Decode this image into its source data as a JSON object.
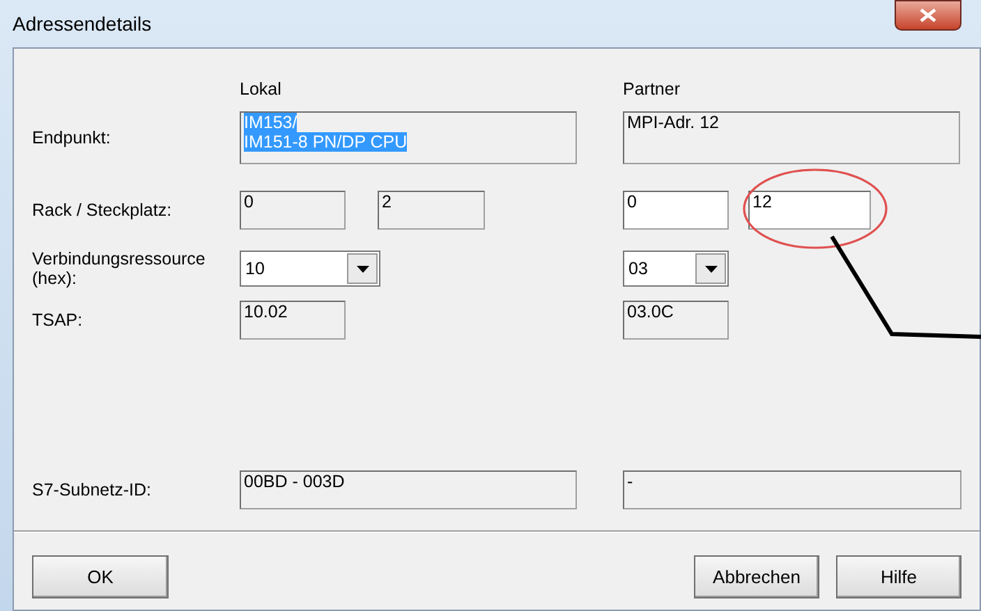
{
  "window": {
    "title": "Adressendetails"
  },
  "columns": [
    "Lokal",
    "Partner"
  ],
  "rows": [
    {
      "label": "Endpunkt:",
      "kind": "wide",
      "local": [
        {
          "value": "IM153/\nIM151-8 PN/DP CPU",
          "disabled": true,
          "selected": true
        }
      ],
      "partner": [
        {
          "value": "MPI-Adr. 12",
          "disabled": true
        }
      ]
    },
    {
      "label": "Rack / Steckplatz:",
      "kind": "pair",
      "local": [
        {
          "value": "0",
          "disabled": true
        },
        {
          "value": "2",
          "disabled": true
        }
      ],
      "partner": [
        {
          "value": "0",
          "disabled": false
        },
        {
          "value": "12",
          "disabled": false
        }
      ]
    },
    {
      "label": "Verbindungsressource\n(hex):",
      "kind": "combo",
      "local": [
        {
          "value": "10",
          "disabled": false
        }
      ],
      "partner": [
        {
          "value": "03",
          "disabled": false
        }
      ]
    },
    {
      "label": "TSAP:",
      "kind": "single",
      "local": [
        {
          "value": "10.02",
          "disabled": true
        }
      ],
      "partner": [
        {
          "value": "03.0C",
          "disabled": true
        }
      ]
    },
    {
      "label": "S7-Subnetz-ID:",
      "kind": "subnet",
      "local": [
        {
          "value": "00BD - 003D",
          "disabled": true
        }
      ],
      "partner": [
        {
          "value": "-",
          "disabled": true
        }
      ]
    }
  ],
  "buttons": [
    {
      "label": "OK",
      "kind": "left"
    },
    {
      "label": "Abbrechen",
      "kind": "right"
    },
    {
      "label": "Hilfe",
      "kind": "right"
    }
  ]
}
